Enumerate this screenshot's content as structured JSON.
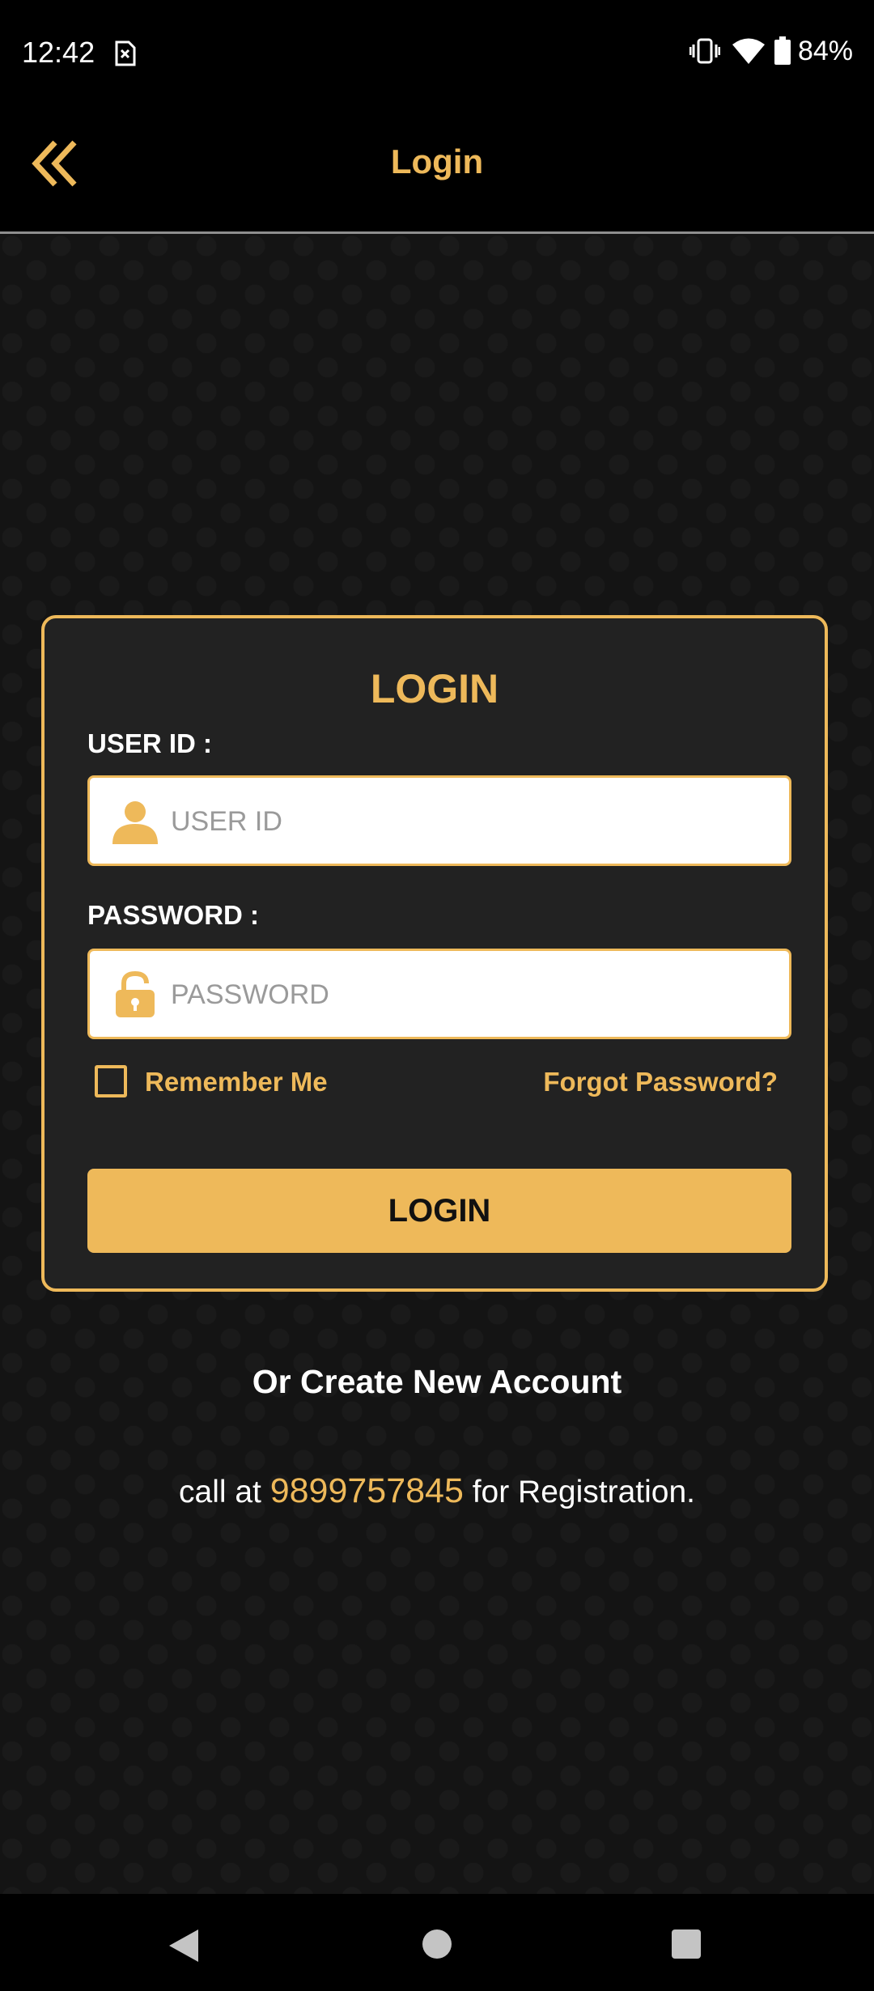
{
  "status_bar": {
    "time": "12:42",
    "battery": "84%",
    "icons": [
      "sim-alert-icon",
      "vibrate-icon",
      "wifi-icon",
      "battery-icon"
    ]
  },
  "header": {
    "title": "Login",
    "back_icon": "double-chevron-left-icon"
  },
  "login_form": {
    "title": "LOGIN",
    "user_id_label": "USER ID :",
    "user_id_placeholder": "USER ID",
    "user_id_value": "",
    "user_icon": "user-icon",
    "password_label": "PASSWORD :",
    "password_placeholder": "PASSWORD",
    "password_value": "",
    "lock_icon": "unlock-icon",
    "remember_me_label": "Remember Me",
    "remember_me_checked": false,
    "forgot_password_label": "Forgot Password?",
    "login_button_label": "LOGIN"
  },
  "footer": {
    "create_account_text": "Or Create New Account",
    "call_prefix": "call at ",
    "phone": "9899757845",
    "call_suffix": " for Registration."
  },
  "colors": {
    "accent": "#eeb95a",
    "background": "#141414",
    "card": "#222222"
  },
  "nav_bar": {
    "icons": [
      "back-triangle-icon",
      "home-circle-icon",
      "recents-square-icon"
    ]
  }
}
